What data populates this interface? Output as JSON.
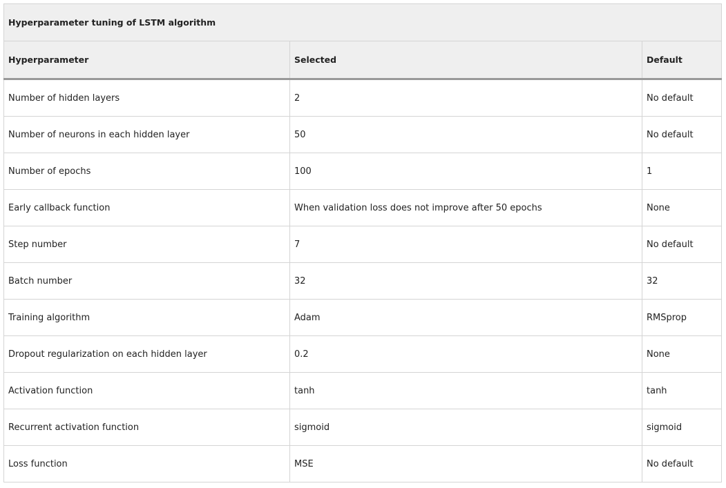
{
  "table": {
    "caption": "Hyperparameter tuning of LSTM algorithm",
    "headers": [
      "Hyperparameter",
      "Selected",
      "Default"
    ],
    "rows": [
      [
        "Number of hidden layers",
        "2",
        "No default"
      ],
      [
        "Number of neurons in each hidden layer",
        "50",
        "No default"
      ],
      [
        "Number of epochs",
        "100",
        "1"
      ],
      [
        "Early callback function",
        "When validation loss does not improve after 50 epochs",
        "None"
      ],
      [
        "Step number",
        "7",
        "No default"
      ],
      [
        "Batch number",
        "32",
        "32"
      ],
      [
        "Training algorithm",
        "Adam",
        "RMSprop"
      ],
      [
        "Dropout regularization on each hidden layer",
        "0.2",
        "None"
      ],
      [
        "Activation function",
        "tanh",
        "tanh"
      ],
      [
        "Recurrent activation function",
        "sigmoid",
        "sigmoid"
      ],
      [
        "Loss function",
        "MSE",
        "No default"
      ]
    ]
  }
}
